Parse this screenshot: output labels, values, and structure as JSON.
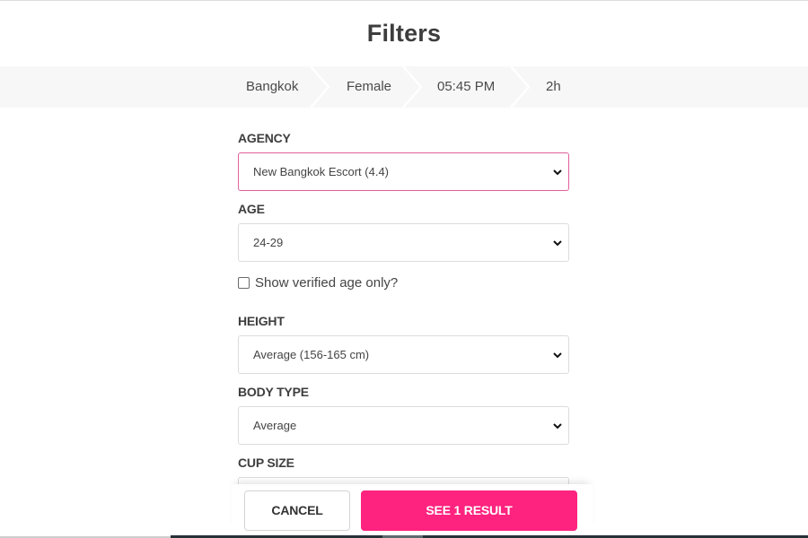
{
  "page": {
    "title": "Filters"
  },
  "breadcrumb": {
    "items": [
      {
        "label": "Bangkok"
      },
      {
        "label": "Female"
      },
      {
        "label": "05:45 PM"
      },
      {
        "label": "2h"
      }
    ]
  },
  "filters": {
    "agency": {
      "label": "AGENCY",
      "value": "New Bangkok Escort (4.4)",
      "icon": "chevron-down-icon"
    },
    "age": {
      "label": "AGE",
      "value": "24-29",
      "icon": "chevron-down-icon"
    },
    "verified_age": {
      "label": "Show verified age only?",
      "checked": false
    },
    "height": {
      "label": "HEIGHT",
      "value": "Average (156-165 cm)",
      "icon": "chevron-down-icon"
    },
    "body_type": {
      "label": "BODY TYPE",
      "value": "Average",
      "icon": "chevron-down-icon"
    },
    "cup_size": {
      "label": "CUP SIZE",
      "value": ""
    }
  },
  "footer": {
    "cancel_label": "CANCEL",
    "see_results_label": "SEE 1 RESULT"
  },
  "colors": {
    "accent": "#fe237f",
    "active_border": "#e0609e",
    "breadcrumb_bg": "#f7f7f7",
    "text": "#3d3d3d"
  }
}
